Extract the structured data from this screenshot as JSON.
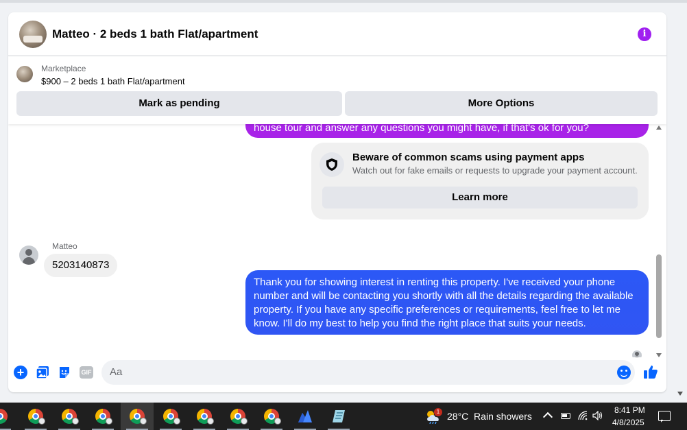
{
  "header": {
    "title": "Matteo · 2 beds 1 bath Flat/apartment"
  },
  "listing": {
    "source": "Marketplace",
    "summary": "$900 – 2 beds 1 bath Flat/apartment",
    "mark_pending_label": "Mark as pending",
    "more_options_label": "More Options"
  },
  "messages": {
    "outgoing_partial": "house tour and answer any questions you might have, if that's ok for you?",
    "scam_notice": {
      "title": "Beware of common scams using payment apps",
      "body": "Watch out for fake emails or requests to upgrade your payment account.",
      "button_label": "Learn more"
    },
    "incoming": {
      "sender": "Matteo",
      "text": "5203140873"
    },
    "outgoing_reply": "Thank you for showing interest in renting this property. I've received your phone number and will be contacting you shortly with all the details regarding the available property. If you have any specific preferences or requirements, feel free to let me know. I'll do my best to help you find the right place that suits your needs."
  },
  "composer": {
    "placeholder": "Aa",
    "gif_label": "GIF"
  },
  "taskbar": {
    "weather_badge": "1",
    "weather": "28°C  Rain showers",
    "time": "8:41 PM",
    "date": "4/8/2025"
  },
  "colors": {
    "accent": "#0866ff",
    "info": "#a020f0",
    "bubble_purple": "#a823e8",
    "bubble_blue": "#3055f3"
  },
  "icons": [
    "info-icon",
    "shield-icon",
    "plus-icon",
    "photo-icon",
    "sticker-icon",
    "gif-icon",
    "emoji-icon",
    "like-icon",
    "chrome-icon",
    "weather-icon",
    "wifi-icon",
    "volume-icon",
    "battery-icon",
    "notification-icon"
  ]
}
